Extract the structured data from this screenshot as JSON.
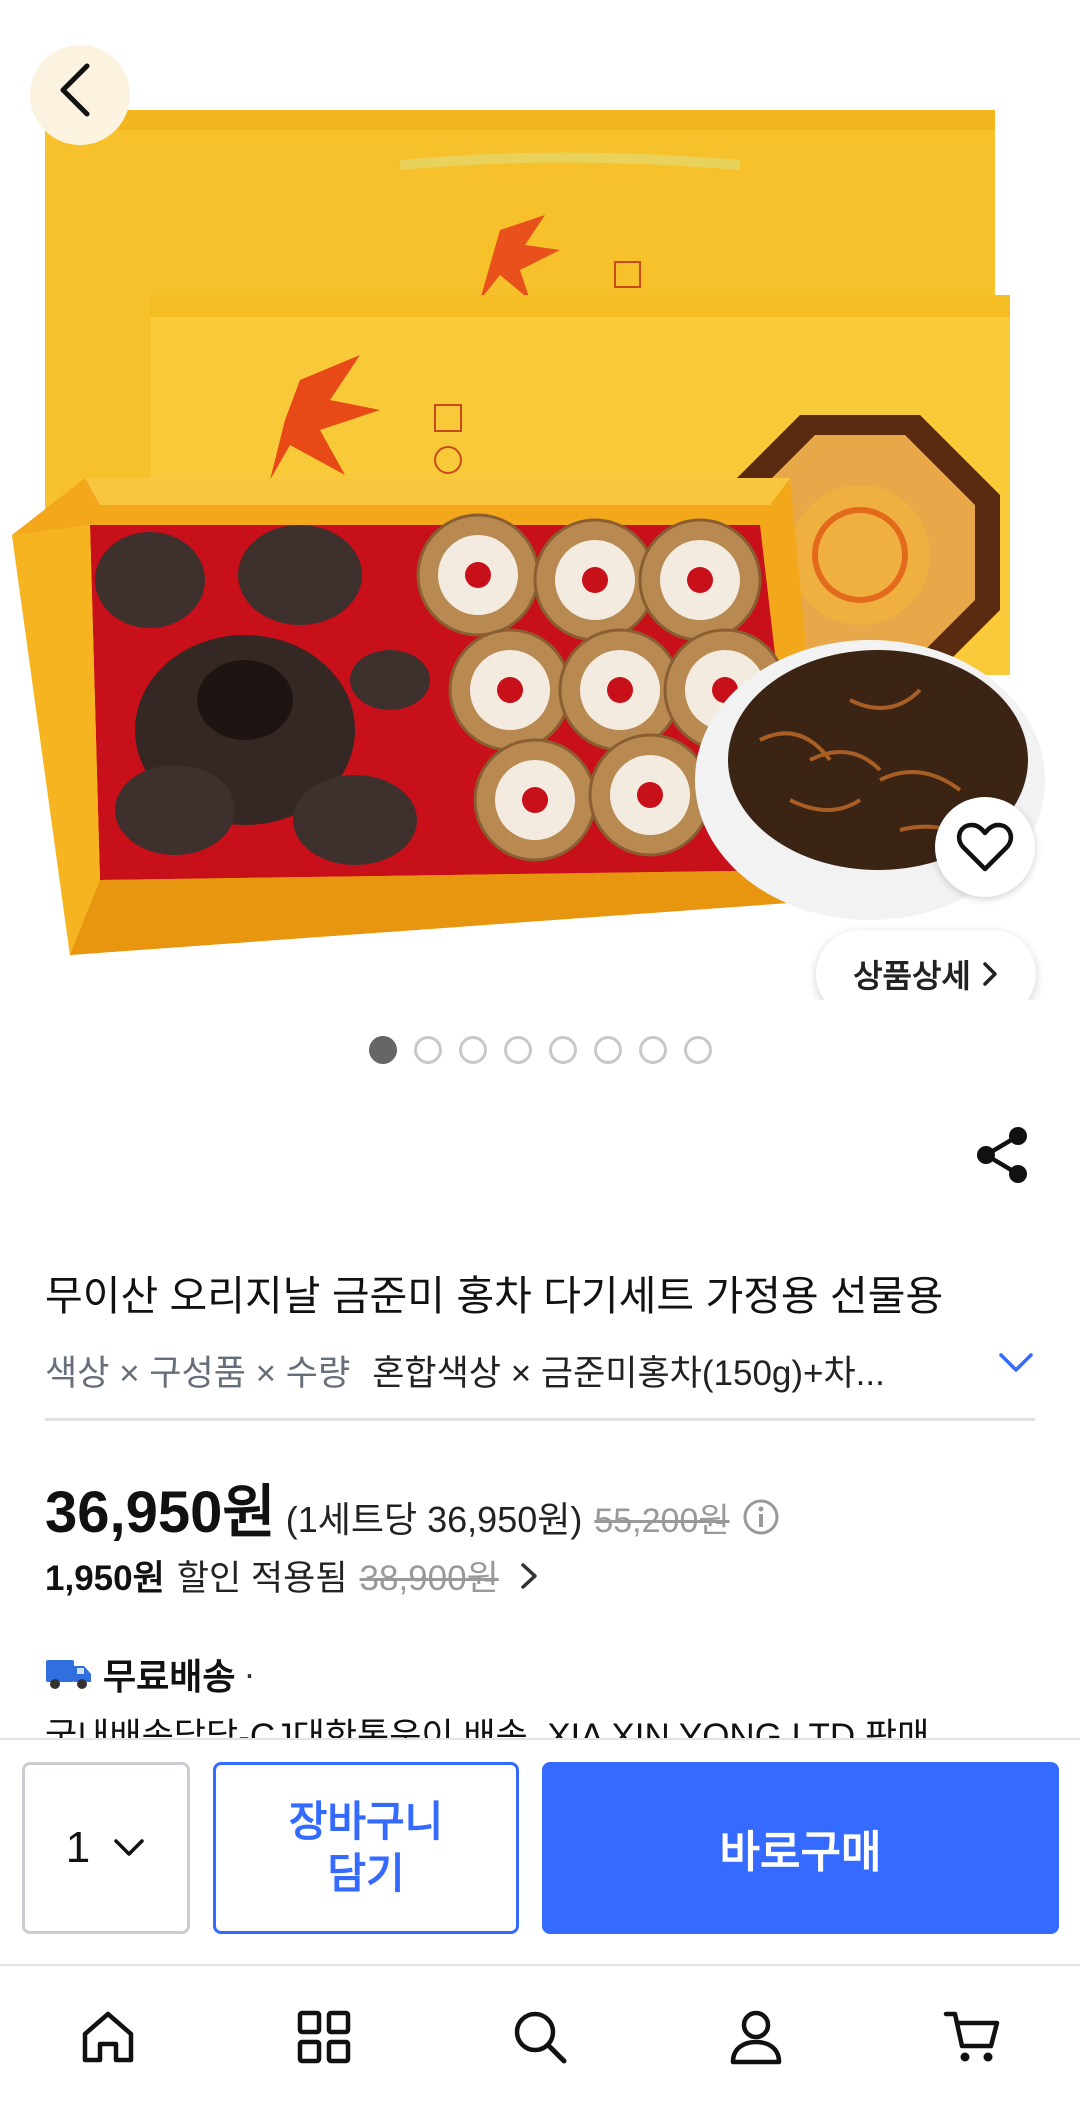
{
  "product": {
    "title": "무이산 오리지날 금준미 홍차 다기세트 가정용 선물용",
    "detail_button_label": "상품상세",
    "image_count": 8,
    "active_image": 1
  },
  "options": {
    "label": "색상 × 구성품 × 수량",
    "value": "혼합색상 × 금준미홍차(150g)+차..."
  },
  "price": {
    "main": "36,950원",
    "unit_price": "(1세트당 36,950원)",
    "original": "55,200원"
  },
  "discount": {
    "amount": "1,950원",
    "text": "할인 적용됨",
    "original": "38,900원"
  },
  "shipping": {
    "label": "무료배송",
    "separator": "·",
    "detail": "국내배송담당-CJ대한통운이 배송, XIA XIN YONG LTD 판매"
  },
  "action_bar": {
    "quantity": "1",
    "cart_label_line1": "장바구니",
    "cart_label_line2": "담기",
    "buy_label": "바로구매"
  },
  "colors": {
    "accent": "#346aff",
    "box_yellow": "#f6c12a",
    "tray_red": "#c8101a"
  },
  "icons": {
    "back": "back-arrow-icon",
    "heart": "heart-icon",
    "share": "share-icon",
    "info": "info-icon",
    "truck": "truck-icon",
    "home": "home-icon",
    "categories": "grid-icon",
    "search": "search-icon",
    "account": "user-icon",
    "cart": "cart-icon"
  }
}
